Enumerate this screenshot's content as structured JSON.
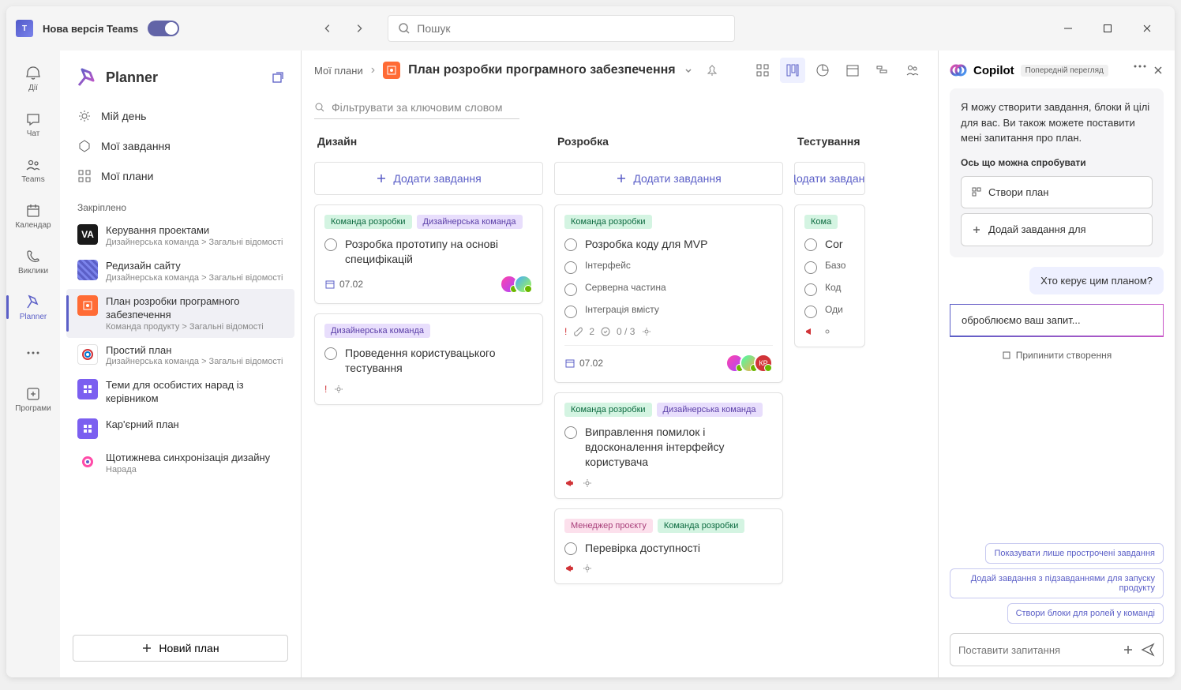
{
  "titlebar": {
    "app_name": "Нова версія Teams",
    "search_placeholder": "Пошук"
  },
  "rail": {
    "items": [
      {
        "label": "Дії"
      },
      {
        "label": "Чат"
      },
      {
        "label": "Teams"
      },
      {
        "label": "Календар"
      },
      {
        "label": "Виклики"
      },
      {
        "label": "Planner"
      },
      {
        "label": ""
      },
      {
        "label": "Програми"
      }
    ]
  },
  "sidebar": {
    "title": "Planner",
    "nav": [
      {
        "label": "Мій день"
      },
      {
        "label": "Мої завдання"
      },
      {
        "label": "Мої плани"
      }
    ],
    "pinned_label": "Закріплено",
    "plans": [
      {
        "name": "Керування проектами",
        "sub": "Дизайнерська команда > Загальні відомості",
        "color": "#1a1a1a",
        "initial": "VA"
      },
      {
        "name": "Редизайн сайту",
        "sub": "Дизайнерська команда > Загальні відомості",
        "color": "#5b5fc7",
        "initial": ""
      },
      {
        "name": "План розробки програмного забезпечення",
        "sub": "Команда продукту > Загальні відомості",
        "color": "#ff6b35",
        "initial": ""
      },
      {
        "name": "Простий план",
        "sub": "Дизайнерська команда > Загальні відомості",
        "color": "#ffffff",
        "initial": ""
      },
      {
        "name": "Теми для особистих нарад із керівником",
        "sub": "",
        "color": "#7b5ff0",
        "initial": ""
      },
      {
        "name": "Кар'єрний план",
        "sub": "",
        "color": "#7b5ff0",
        "initial": ""
      },
      {
        "name": "Щотижнева синхронізація дизайну",
        "sub": "Нарада",
        "color": "#ff4ba8",
        "initial": ""
      }
    ],
    "new_plan": "Новий план"
  },
  "main": {
    "breadcrumb_root": "Мої плани",
    "plan_title": "План розробки програмного забезпечення",
    "filter_placeholder": "Фільтрувати за ключовим словом",
    "add_task_label": "Додати завдання",
    "columns": [
      {
        "title": "Дизайн",
        "cards": [
          {
            "tags": [
              {
                "text": "Команда розробки",
                "cls": "tag-green"
              },
              {
                "text": "Дизайнерська команда",
                "cls": "tag-purple"
              }
            ],
            "title": "Розробка прототипу на основі специфікацій",
            "date": "07.02",
            "avatars": 2
          },
          {
            "tags": [
              {
                "text": "Дизайнерська команда",
                "cls": "tag-purple"
              }
            ],
            "title": "Проведення користувацького тестування",
            "priority": true
          }
        ]
      },
      {
        "title": "Розробка",
        "cards": [
          {
            "tags": [
              {
                "text": "Команда розробки",
                "cls": "tag-green"
              }
            ],
            "title": "Розробка коду для MVP",
            "subtasks": [
              "Інтерфейс",
              "Серверна частина",
              "Інтеграція вмісту"
            ],
            "attach": "2",
            "check": "0 / 3",
            "priority": true,
            "date": "07.02",
            "avatars": 3,
            "kr_avatar": true
          },
          {
            "tags": [
              {
                "text": "Команда розробки",
                "cls": "tag-green"
              },
              {
                "text": "Дизайнерська команда",
                "cls": "tag-purple"
              }
            ],
            "title": "Виправлення помилок і вдосконалення інтерфейсу користувача",
            "megaphone": true
          },
          {
            "tags": [
              {
                "text": "Менеджер проєкту",
                "cls": "tag-pink"
              },
              {
                "text": "Команда розробки",
                "cls": "tag-green"
              }
            ],
            "title": "Перевірка доступності",
            "megaphone": true
          }
        ]
      },
      {
        "title": "Тестування",
        "cards_partial": [
          {
            "title": "Cor"
          },
          {
            "title": "Базо"
          },
          {
            "title": "Код"
          },
          {
            "title": "Оди"
          }
        ]
      }
    ]
  },
  "copilot": {
    "title": "Copilot",
    "badge": "Попередній перегляд",
    "intro": "Я можу створити завдання, блоки й цілі для вас. Ви також можете поставити мені запитання про план.",
    "try_label": "Ось що можна спробувати",
    "actions": [
      "Створи план",
      "Додай завдання для"
    ],
    "user_msg": "Хто керує цим планом?",
    "processing": "оброблюємо ваш запит...",
    "stop": "Припинити створення",
    "suggestions": [
      "Показувати лише прострочені завдання",
      "Додай завдання з підзавданнями для запуску продукту",
      "Створи блоки для ролей у команді"
    ],
    "input_placeholder": "Поставити запитання"
  }
}
